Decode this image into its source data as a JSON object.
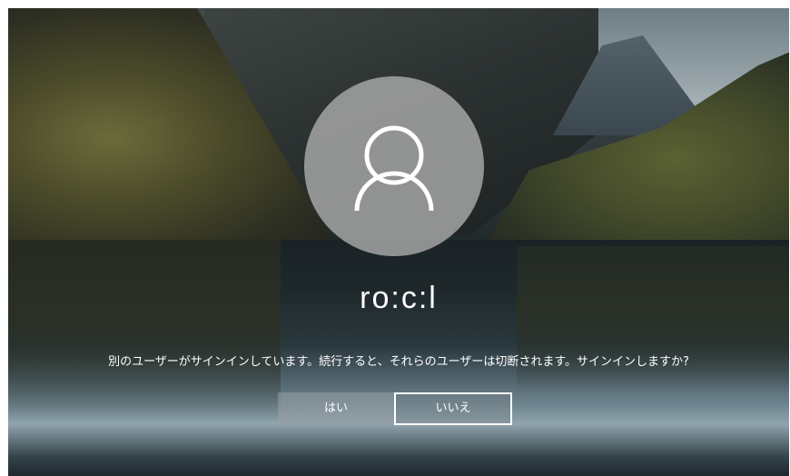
{
  "user": {
    "name": "ro:c:l",
    "avatar_icon": "user-icon"
  },
  "dialog": {
    "message": "別のユーザーがサインインしています。続行すると、それらのユーザーは切断されます。サインインしますか?",
    "yes_label": "はい",
    "no_label": "いいえ"
  },
  "colors": {
    "text": "#ffffff",
    "avatar_bg": "#aaaaaa",
    "button_focus_border": "#ffffff"
  }
}
